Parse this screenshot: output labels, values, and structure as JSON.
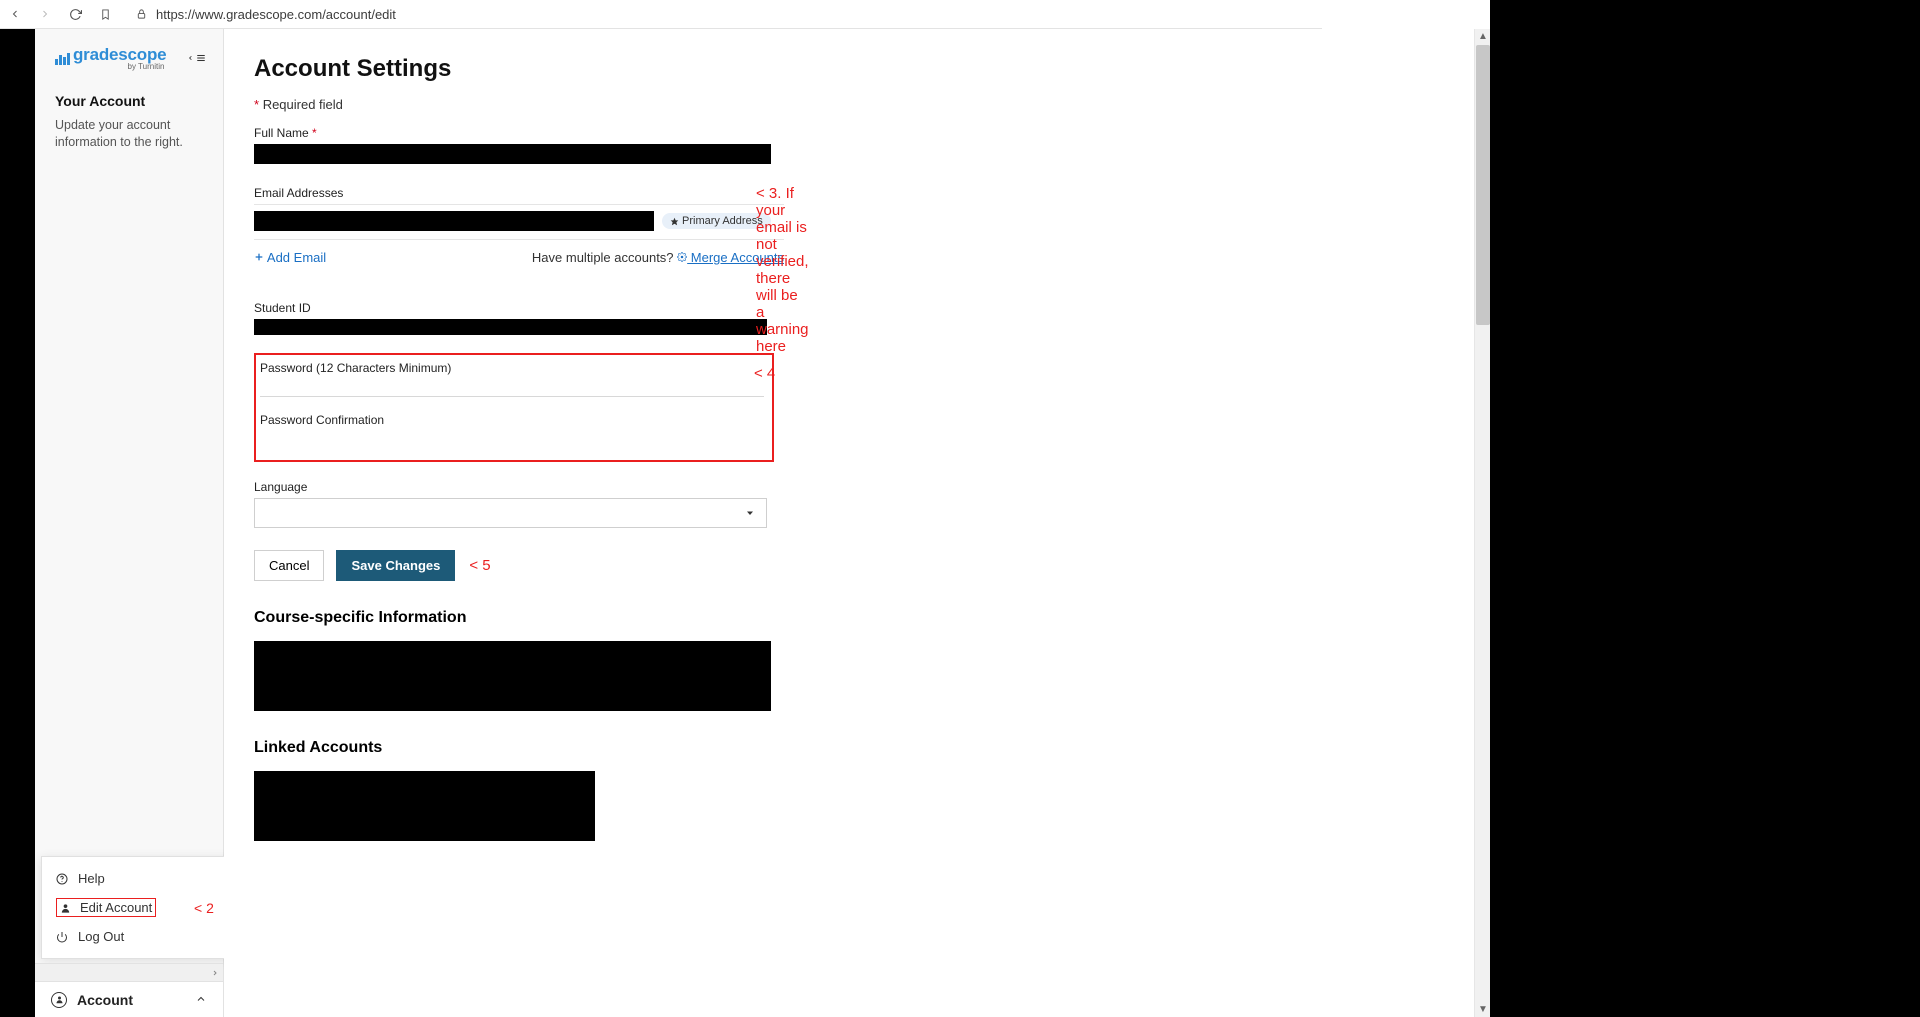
{
  "browser": {
    "url": "https://www.gradescope.com/account/edit"
  },
  "logo": {
    "text": "gradescope",
    "byline": "by Turnitin"
  },
  "sidebar": {
    "title": "Your Account",
    "description": "Update your account information to the right."
  },
  "account_menu": {
    "help": "Help",
    "edit_account": "Edit Account",
    "log_out": "Log Out",
    "trigger": "Account"
  },
  "page": {
    "title": "Account Settings",
    "required_note": "Required field",
    "full_name_label": "Full Name",
    "email_label": "Email Addresses",
    "primary_badge": "Primary Address",
    "add_email": "Add Email",
    "merge_prompt": "Have multiple accounts?",
    "merge_link": " Merge Accounts",
    "student_id_label": "Student ID",
    "password_label": "Password (12 Characters Minimum)",
    "password_confirm_label": "Password Confirmation",
    "language_label": "Language",
    "cancel": "Cancel",
    "save": "Save Changes",
    "course_info_title": "Course-specific Information",
    "linked_title": "Linked Accounts"
  },
  "annotations": {
    "step2": "<  2",
    "step3": "< 3. If your email is not verified, there will be a warning here",
    "step4": "<  4",
    "step5": "<  5"
  }
}
